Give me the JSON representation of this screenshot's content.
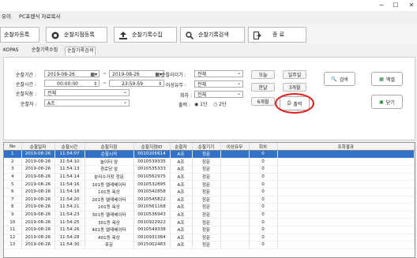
{
  "window": {
    "minimize": "─",
    "maximize": "☐",
    "close": "✕"
  },
  "menu": [
    "유이",
    "PC포렌식 자료복사"
  ],
  "toolbar": [
    {
      "label": "순찰자등록"
    },
    {
      "label": "순찰지점등록"
    },
    {
      "label": "순찰기록수집"
    },
    {
      "label": "순찰기록검색"
    },
    {
      "label": "종 료"
    }
  ],
  "tabs": [
    "KOPAS",
    "순찰기록수집",
    "순찰기록검색"
  ],
  "filters": {
    "period_label": "순찰기간 :",
    "date_from": "2019-08-26",
    "date_to": "2019-08-26",
    "time_label": "순찰시간 :",
    "time_from": "00:00:00",
    "time_to": "23:59:59",
    "point_label": "순찰지점 :",
    "point_value": "전체",
    "patroller_label": "순찰자 :",
    "patroller_value": "A조",
    "reader_label": "순찰리더기 :",
    "reader_value": "전체",
    "abnormal_label": "이상유무 :",
    "abnormal_value": "전체",
    "round_label": "회차 :",
    "round_value": "전체",
    "output_label": "출력 :",
    "output_opt1": "1단",
    "output_opt2": "2단"
  },
  "quick": [
    "오늘",
    "일주일",
    "한달",
    "3개월",
    "6개월",
    "1년"
  ],
  "actions": {
    "search": "검색",
    "excel": "엑셀",
    "print": "출력",
    "close": "닫기"
  },
  "colors": {
    "selected": "#2f72c8",
    "highlight": "#e01e1e"
  },
  "grid": {
    "headers": [
      "No",
      "순찰일자",
      "순찰시간",
      "순찰지점",
      "순찰지점ID",
      "순찰자",
      "순찰기기",
      "이상유무",
      "회차",
      "조회결과"
    ],
    "rows": [
      [
        "1",
        "2019-08-26",
        "11:54:07",
        "순찰시작",
        "0010205614",
        "A조",
        "정문",
        "",
        "0",
        ""
      ],
      [
        "2",
        "2019-08-26",
        "11:54:10",
        "놀이터 앞",
        "0010539335",
        "A조",
        "정문",
        "",
        "0",
        ""
      ],
      [
        "3",
        "2019-08-26",
        "11:54:13",
        "경로당 앞",
        "0010535333",
        "A조",
        "정문",
        "",
        "0",
        ""
      ],
      [
        "4",
        "2019-08-26",
        "11:54:14",
        "분리수거장 정문",
        "0010562975",
        "A조",
        "정문",
        "",
        "0",
        ""
      ],
      [
        "5",
        "2019-08-26",
        "11:54:16",
        "101동 엘레베이터",
        "0010532895",
        "A조",
        "정문",
        "",
        "0",
        ""
      ],
      [
        "6",
        "2019-08-26",
        "11:54:18",
        "101동 옥상",
        "0010542858",
        "A조",
        "정문",
        "",
        "0",
        ""
      ],
      [
        "7",
        "2019-08-26",
        "11:54:20",
        "201동 엘레베이터",
        "0010545822",
        "A조",
        "정문",
        "",
        "0",
        ""
      ],
      [
        "8",
        "2019-08-26",
        "11:54:21",
        "201동 옥상",
        "0010561168",
        "A조",
        "정문",
        "",
        "0",
        ""
      ],
      [
        "9",
        "2019-08-26",
        "11:54:23",
        "301동 엘레베이터",
        "0010536943",
        "A조",
        "정문",
        "",
        "0",
        ""
      ],
      [
        "10",
        "2019-08-26",
        "11:54:25",
        "301동 옥상",
        "0010922922",
        "A조",
        "정문",
        "",
        "0",
        ""
      ],
      [
        "11",
        "2019-08-26",
        "11:54:26",
        "401동 엘레베이터",
        "0010549338",
        "A조",
        "정문",
        "",
        "0",
        ""
      ],
      [
        "12",
        "2019-08-26",
        "11:54:28",
        "401동 옥상",
        "0010931384",
        "A조",
        "정문",
        "",
        "0",
        ""
      ],
      [
        "13",
        "2019-08-26",
        "11:54:30",
        "후문",
        "0015002483",
        "A조",
        "정문",
        "",
        "0",
        ""
      ]
    ]
  }
}
